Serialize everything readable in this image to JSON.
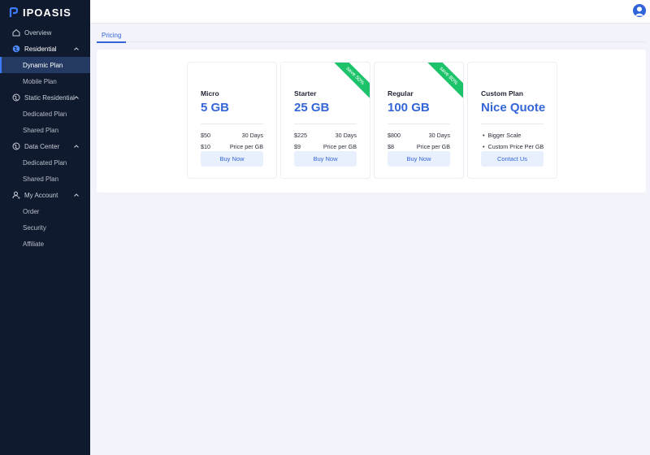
{
  "brand": {
    "name": "IPOASIS"
  },
  "sidebar": {
    "overview": "Overview",
    "residential": "Residential",
    "dynamic_plan": "Dynamic Plan",
    "mobile_plan": "Mobile Plan",
    "static_residential": "Static Residential",
    "static_dedicated": "Dedicated Plan",
    "static_shared": "Shared Plan",
    "data_center": "Data Center",
    "dc_dedicated": "Dedicated Plan",
    "dc_shared": "Shared Plan",
    "my_account": "My Account",
    "order": "Order",
    "security": "Security",
    "affiliate": "Affiliate"
  },
  "tabs": {
    "pricing": "Pricing"
  },
  "plans": [
    {
      "name": "Micro",
      "size": "5 GB",
      "row1_left": "$50",
      "row1_right": "30 Days",
      "row2_left": "$10",
      "row2_right": "Price per GB",
      "button": "Buy Now"
    },
    {
      "name": "Starter",
      "size": "25 GB",
      "row1_left": "$225",
      "row1_right": "30 Days",
      "row2_left": "$9",
      "row2_right": "Price per GB",
      "button": "Buy Now",
      "ribbon": "save 50%"
    },
    {
      "name": "Regular",
      "size": "100 GB",
      "row1_left": "$800",
      "row1_right": "30 Days",
      "row2_left": "$8",
      "row2_right": "Price per GB",
      "button": "Buy Now",
      "ribbon": "save 80%"
    },
    {
      "name": "Custom Plan",
      "size": "Nice Quote",
      "bullet1": "Bigger Scale",
      "bullet2": "Custom Price Per GB",
      "button": "Contact Us"
    }
  ],
  "colors": {
    "sidebar_bg": "#101a2e",
    "accent": "#3466d8",
    "ribbon": "#1dc36a",
    "page_bg": "#f2f3fb"
  },
  "icons": [
    "logo-icon",
    "home-icon",
    "globe-icon",
    "chevron-up-icon",
    "user-icon",
    "avatar-icon"
  ]
}
